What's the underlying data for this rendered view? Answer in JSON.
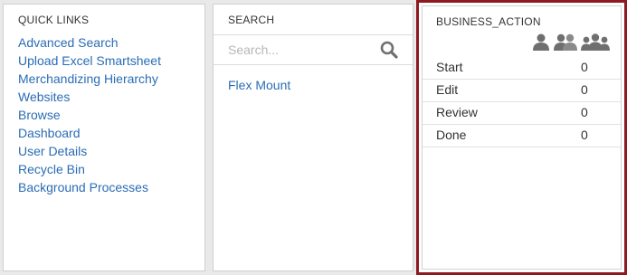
{
  "quick_links": {
    "title": "QUICK LINKS",
    "items": [
      "Advanced Search",
      "Upload Excel Smartsheet",
      "Merchandizing Hierarchy",
      "Websites",
      "Browse",
      "Dashboard",
      "User Details",
      "Recycle Bin",
      "Background Processes"
    ]
  },
  "search": {
    "title": "SEARCH",
    "placeholder": "Search...",
    "results": [
      "Flex Mount"
    ]
  },
  "business_action": {
    "title": "BUSINESS_ACTION",
    "icons": [
      "single-user-icon",
      "two-users-icon",
      "group-users-icon"
    ],
    "rows": [
      {
        "label": "Start",
        "count": "0"
      },
      {
        "label": "Edit",
        "count": "0"
      },
      {
        "label": "Review",
        "count": "0"
      },
      {
        "label": "Done",
        "count": "0"
      }
    ],
    "highlight_color": "#8e1a1f"
  },
  "colors": {
    "link": "#2a6db5",
    "background": "#e9e9e9",
    "icon_gray": "#6f6f6f"
  }
}
